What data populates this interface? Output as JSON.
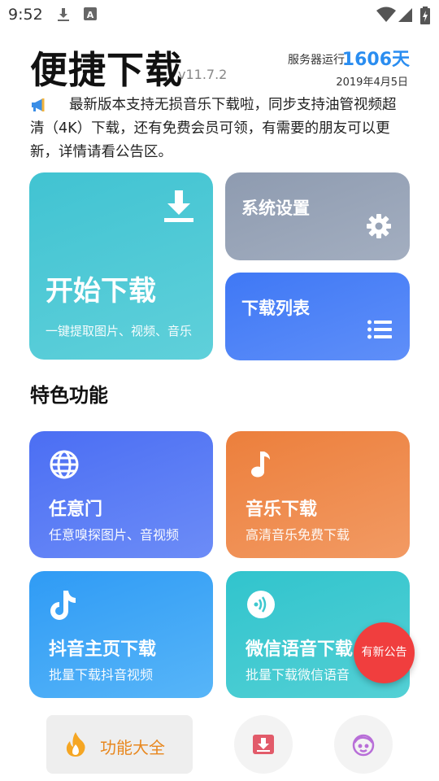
{
  "status_bar": {
    "time": "9:52",
    "icons": [
      "download-icon",
      "a-icon",
      "wifi-icon",
      "signal-icon",
      "battery-icon"
    ]
  },
  "header": {
    "title": "便捷下载",
    "version": "v11.7.2",
    "server_label": "服务器运行",
    "server_days": "1606天",
    "server_date": "2019年4月5日"
  },
  "notice": {
    "icon": "megaphone-icon",
    "text": "最新版本支持无损音乐下载啦，同步支持油管视频超清（4K）下载，还有免费会员可领，有需要的朋友可以更新，详情请看公告区。"
  },
  "main_cards": {
    "start_download": {
      "title": "开始下载",
      "subtitle": "一键提取图片、视频、音乐",
      "icon": "download-icon",
      "color": "#41c3d2"
    },
    "settings": {
      "title": "系统设置",
      "icon": "gear-icon",
      "color": "#8e9bb0"
    },
    "download_list": {
      "title": "下载列表",
      "icon": "list-icon",
      "color": "#3f78f5"
    }
  },
  "features": {
    "section_title": "特色功能",
    "items": [
      {
        "title": "任意门",
        "subtitle": "任意嗅探图片、音视频",
        "icon": "globe-icon",
        "color": "#4b6ef3"
      },
      {
        "title": "音乐下载",
        "subtitle": "高清音乐免费下载",
        "icon": "music-note-icon",
        "color": "#ec7f3c"
      },
      {
        "title": "抖音主页下载",
        "subtitle": "批量下载抖音视频",
        "icon": "tiktok-icon",
        "color": "#2f9bf5"
      },
      {
        "title": "微信语音下载",
        "subtitle": "批量下载微信语音",
        "icon": "voice-icon",
        "color": "#31c4cd"
      }
    ]
  },
  "fab": {
    "label": "有新公告",
    "color": "#f03e3e"
  },
  "bottom_nav": {
    "items": [
      {
        "label": "功能大全",
        "icon": "flame-icon",
        "active": true
      },
      {
        "label": "",
        "icon": "download-box-icon",
        "active": false
      },
      {
        "label": "",
        "icon": "face-icon",
        "active": false
      }
    ]
  }
}
